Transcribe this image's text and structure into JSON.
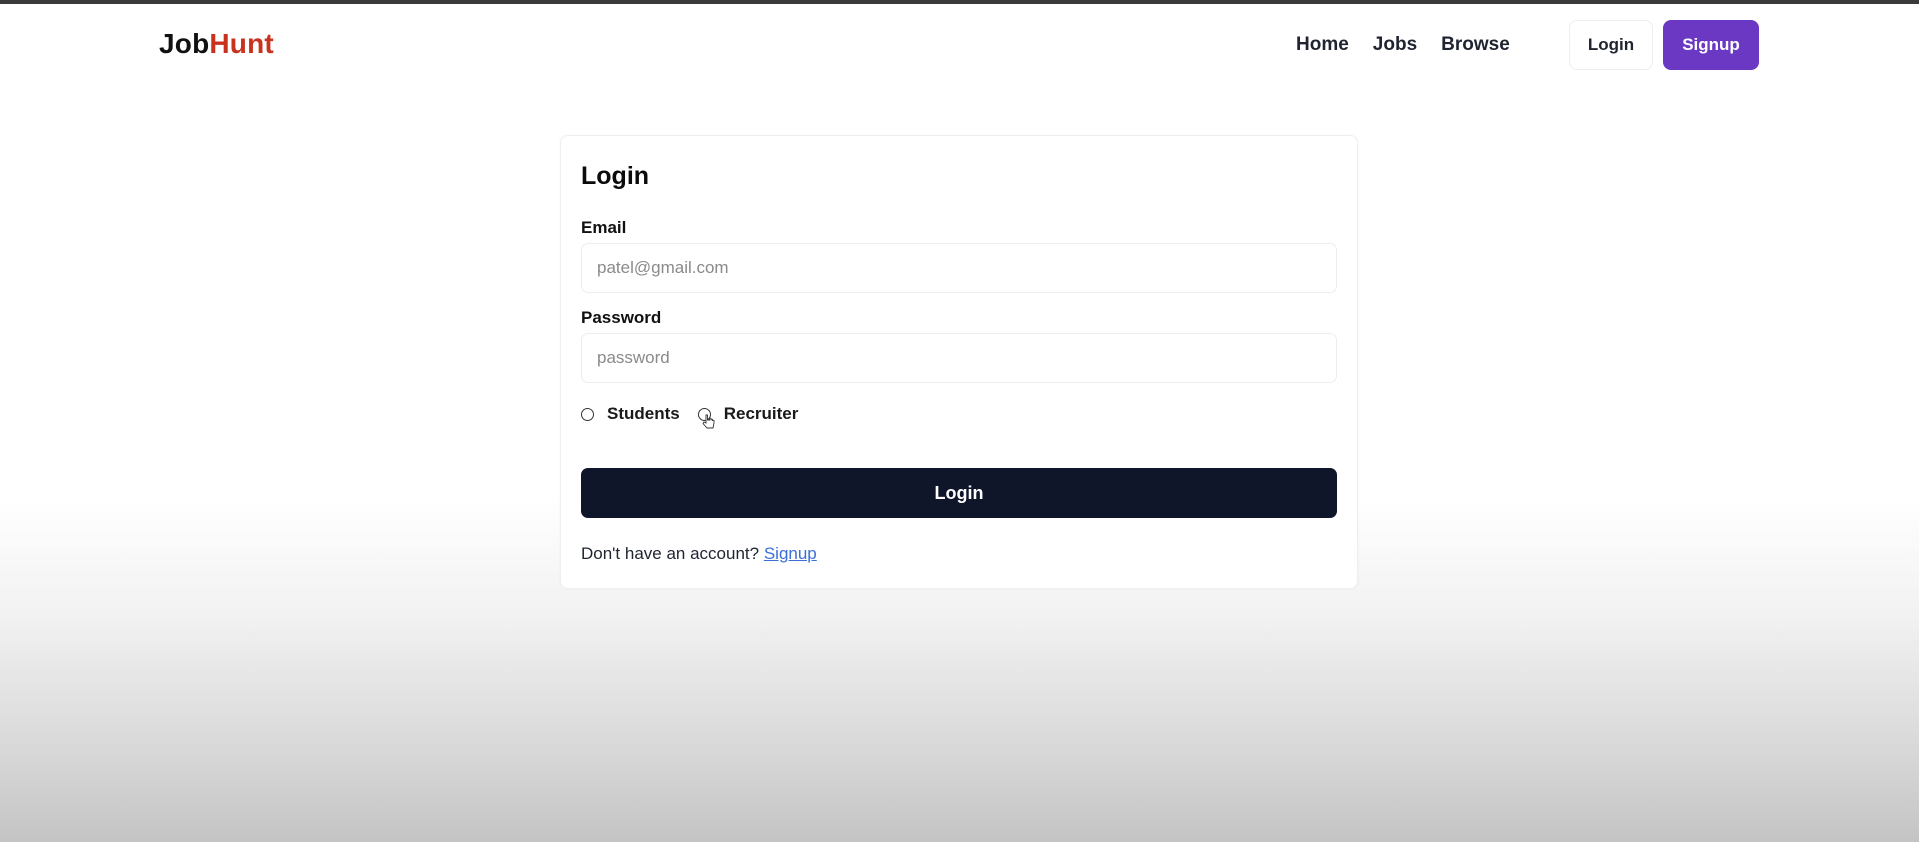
{
  "navbar": {
    "brand_part1": "Job",
    "brand_part2": "Hunt",
    "links": [
      "Home",
      "Jobs",
      "Browse"
    ],
    "login_label": "Login",
    "signup_label": "Signup"
  },
  "form": {
    "title": "Login",
    "email_label": "Email",
    "email_placeholder": "patel@gmail.com",
    "password_label": "Password",
    "password_placeholder": "password",
    "roles": [
      "Students",
      "Recruiter"
    ],
    "submit_label": "Login",
    "signup_prompt": "Don't have an account?",
    "signup_link": "Signup"
  },
  "colors": {
    "brand_accent": "#c8321f",
    "signup_button": "#6a38c2",
    "submit_button": "#0f1629",
    "link": "#3b6fd8"
  }
}
